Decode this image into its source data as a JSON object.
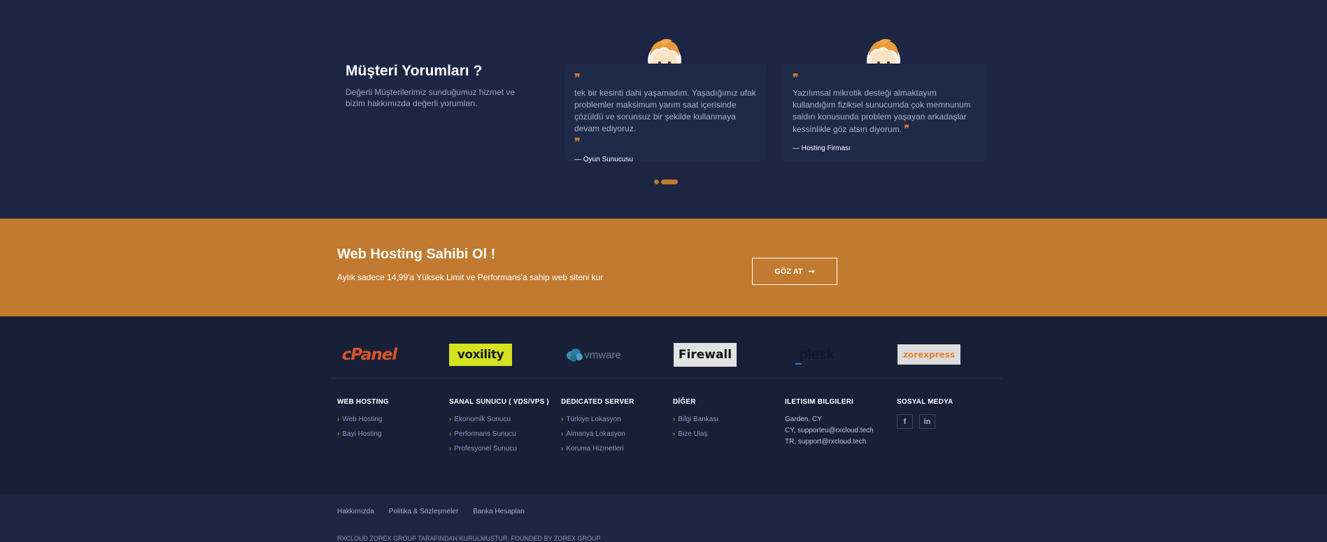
{
  "testimonials": {
    "title": "Müşteri Yorumları ?",
    "subtitle": "Değerli Müşterilerimiz sunduğumuz hizmet ve bizim hakkımızda değerli yorumları.",
    "items": [
      {
        "text": "tek bir kesinti dahi yaşamadım. Yaşadığımız ufak problemler maksimum yarım saat içerisinde çözüldü ve sorunsuz bir şekilde kullanmaya devam ediyoruz.",
        "author": "— Oyun Sunucusu"
      },
      {
        "text": "Yazılımsal mikrotik desteği almaktayım kullandığım fiziksel sunucumda çok memnunum saldırı konusunda problem yaşayan arkadaşlar kessinlikle göz atsın diyorum.",
        "author": "— Hosting Firması"
      }
    ],
    "quote_mark": "❞"
  },
  "cta": {
    "title": "Web Hosting Sahibi Ol !",
    "subtitle": "Aylık sadece 14,99'a Yüksek Limit ve Performans'a sahip web siteni kur",
    "button_label": "GÖZ AT",
    "button_arrow": "➞"
  },
  "partners": {
    "cpanel": "cPanel",
    "voxility": "voxility",
    "vmware": "vmware",
    "firewall": "Firewall",
    "plesk": "plesk",
    "zorexpress": "zorexpress"
  },
  "footer": {
    "columns": [
      {
        "title": "WEB HOSTING",
        "items": [
          "Web Hosting",
          "Bayi Hosting"
        ]
      },
      {
        "title": "SANAL SUNUCU ( VDS/VPS )",
        "items": [
          "Ekonomik Sunucu",
          "Performans Sunucu",
          "Profesyonel Sunucu"
        ]
      },
      {
        "title": "DEDICATED SERVER",
        "items": [
          "Türkiye Lokasyon",
          "Almanya Lokasyon",
          "Koruma Hizmetleri"
        ]
      },
      {
        "title": "DİĞER",
        "items": [
          "Bilgi Bankası",
          "Bize Ulaş"
        ]
      }
    ],
    "contact": {
      "title": "ILETISIM BILGILERI",
      "lines": [
        "Garden, CY",
        "CY, supporteu@rxcloud.tech",
        "TR, support@rxcloud.tech"
      ]
    },
    "social": {
      "title": "SOSYAL MEDYA",
      "facebook": "f",
      "linkedin": "in"
    },
    "chevron": "›"
  },
  "bottom": {
    "links": [
      "Hakkımızda",
      "Politika & Sözleşmeler",
      "Banka Hesapları"
    ],
    "copyright": "RXCLOUD ZOREX GROUP TARAFINDAN KURULMUŞTUR. FOUNDED BY ZOREX GROUP"
  },
  "colors": {
    "background": "#1c2544",
    "accent": "#c17a2f",
    "footer": "#182038"
  }
}
